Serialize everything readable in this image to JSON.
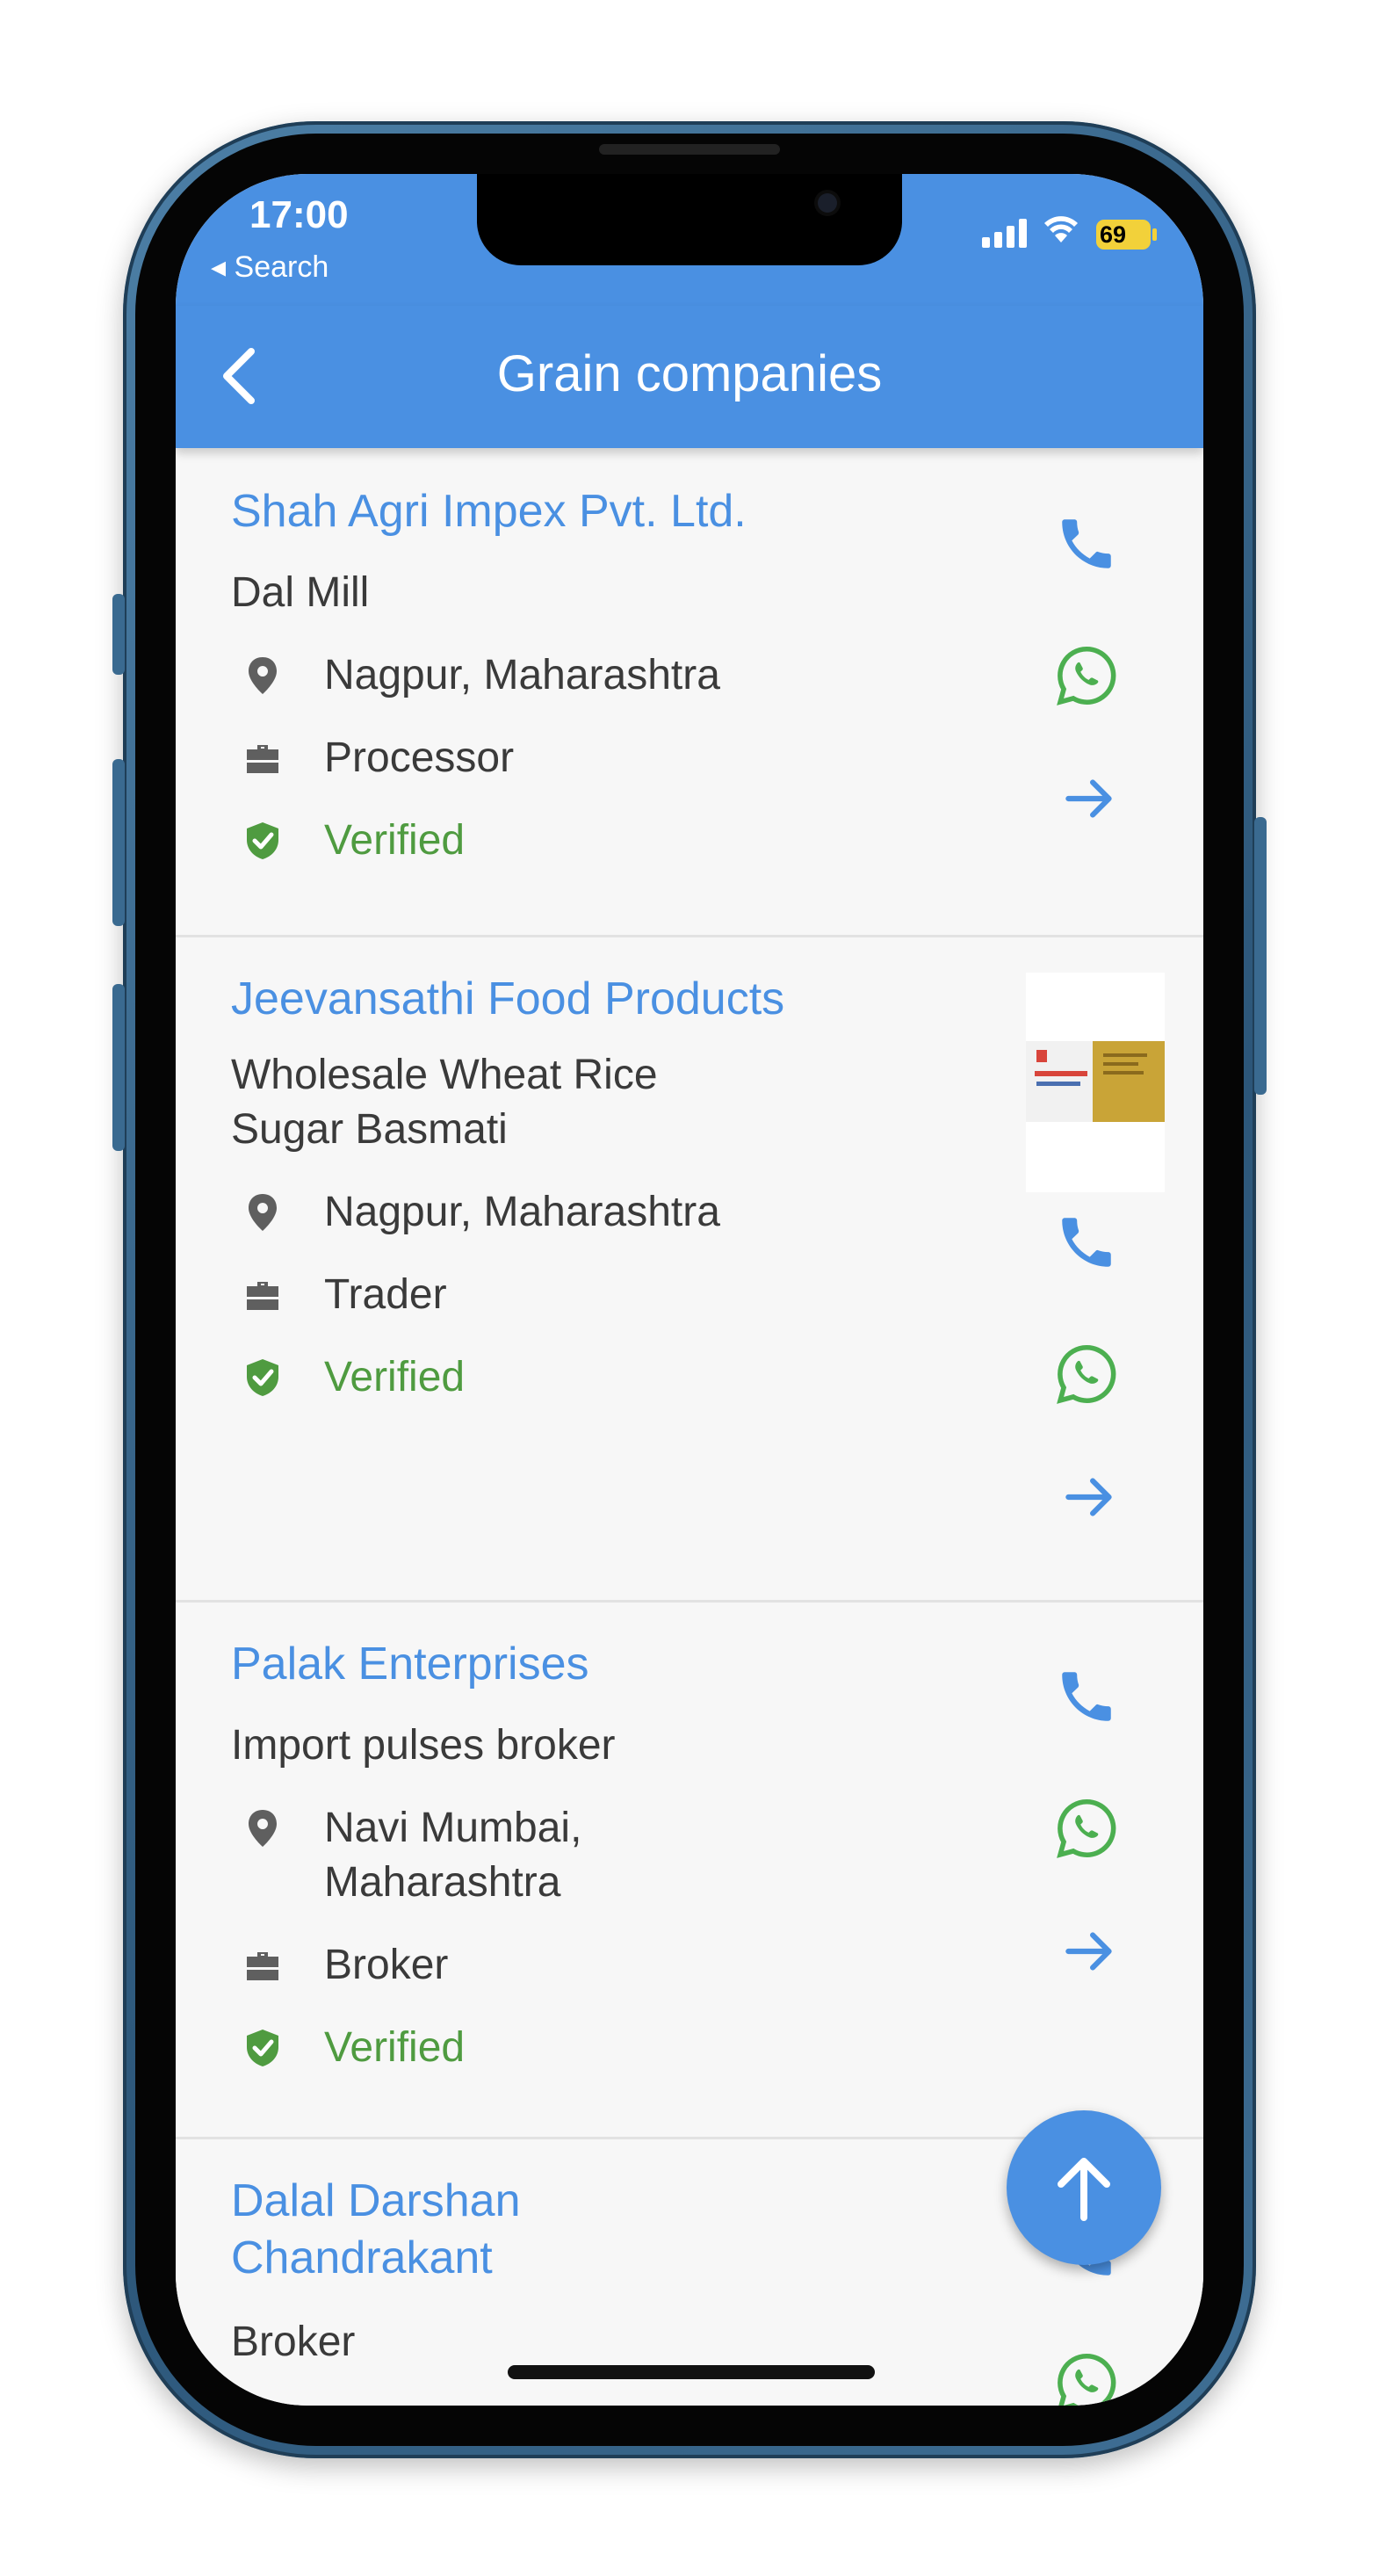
{
  "status_bar": {
    "time": "17:00",
    "back_app": "◂ Search",
    "battery": "69"
  },
  "app_bar": {
    "title": "Grain companies",
    "back_icon": "chevron-left-icon"
  },
  "colors": {
    "brand_blue": "#4a90e2",
    "verified_green": "#4f9b40",
    "whatsapp_green": "#4caf50",
    "icon_grey": "#5f5f5f"
  },
  "companies": [
    {
      "name": "Shah Agri Impex Pvt. Ltd.",
      "category": "Dal Mill",
      "location": "Nagpur, Maharashtra",
      "role": "Processor",
      "status": "Verified"
    },
    {
      "name": "Jeevansathi Food Products",
      "category_line1": "Wholesale Wheat Rice",
      "category_line2": "Sugar Basmati",
      "location": "Nagpur, Maharashtra",
      "role": "Trader",
      "status": "Verified",
      "thumbnail_text": "Jeevansathi"
    },
    {
      "name": "Palak Enterprises",
      "category": "Import pulses broker",
      "location_line1": "Navi Mumbai,",
      "location_line2": "Maharashtra",
      "role": "Broker",
      "status": "Verified"
    },
    {
      "name_line1": "Dalal Darshan",
      "name_line2": "Chandrakant",
      "category": "Broker"
    }
  ],
  "icons": {
    "location": "map-pin-icon",
    "role": "briefcase-icon",
    "verified": "shield-check-icon",
    "call": "phone-icon",
    "whatsapp": "whatsapp-icon",
    "open": "arrow-right-icon",
    "scroll_top": "arrow-up-icon"
  }
}
